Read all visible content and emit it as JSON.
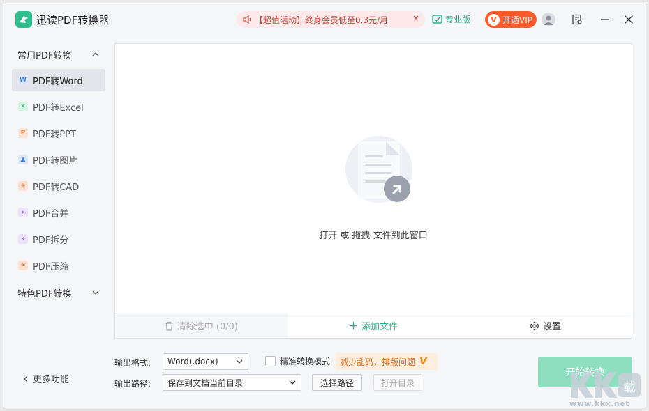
{
  "app": {
    "title": "迅读PDF转换器"
  },
  "titlebar": {
    "promo_text": "【超值活动】终身会员低至0.3元/月",
    "promo_close": "×",
    "pro_label": "专业版",
    "vip_badge": "V",
    "vip_label": "开通VIP"
  },
  "sidebar": {
    "group_common": "常用PDF转换",
    "items": [
      {
        "label": "PDF转Word",
        "icon": "word-icon",
        "color": "#3f7ff2"
      },
      {
        "label": "PDF转Excel",
        "icon": "excel-icon",
        "color": "#25b37a"
      },
      {
        "label": "PDF转PPT",
        "icon": "ppt-icon",
        "color": "#f07a3a"
      },
      {
        "label": "PDF转图片",
        "icon": "image-icon",
        "color": "#3a7fe0"
      },
      {
        "label": "PDF转CAD",
        "icon": "cad-icon",
        "color": "#f0783a"
      },
      {
        "label": "PDF合并",
        "icon": "merge-icon",
        "color": "#8a5af0"
      },
      {
        "label": "PDF拆分",
        "icon": "split-icon",
        "color": "#8a5af0"
      },
      {
        "label": "PDF压缩",
        "icon": "compress-icon",
        "color": "#f0783a"
      }
    ],
    "group_special": "特色PDF转换",
    "more": "更多功能"
  },
  "main": {
    "drop_text": "打开 或 拖拽 文件到此窗口",
    "clear_label": "清除选中 (0/0)",
    "add_label": "添加文件",
    "settings_label": "设置"
  },
  "controls": {
    "format_label": "输出格式:",
    "format_value": "Word(.docx)",
    "precise_label": "精准转换模式",
    "hint": "减少乱码，排版问题",
    "hint_mark": "V",
    "path_label": "输出路径:",
    "path_value": "保存到文档当前目录",
    "choose_path": "选择路径",
    "open_dir": "打开目录",
    "start": "开始转换"
  },
  "watermark": {
    "text": "www.kkx.net"
  },
  "colors": {
    "accent": "#2fb08a",
    "vip": "#ff5a2a",
    "start_disabled": "#8edfc2"
  }
}
